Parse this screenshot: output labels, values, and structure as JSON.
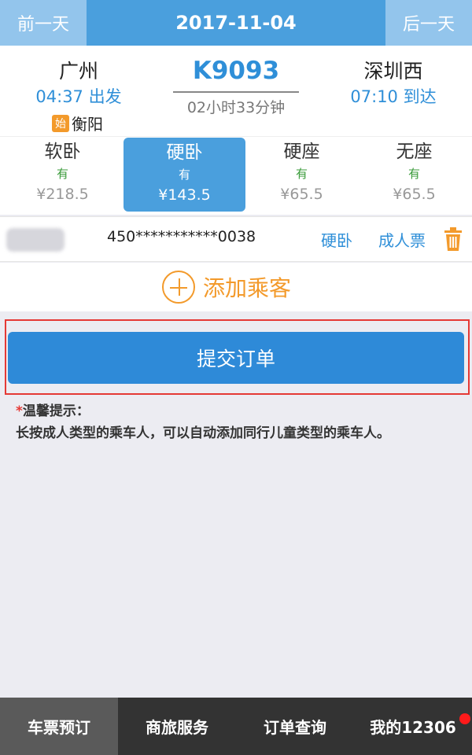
{
  "datebar": {
    "prev_label": "前一天",
    "date": "2017-11-04",
    "next_label": "后一天"
  },
  "train": {
    "from_station": "广州",
    "from_time": "04:37 出发",
    "origin_badge": "始",
    "origin_station": "衡阳",
    "number": "K9093",
    "duration": "02小时33分钟",
    "to_station": "深圳西",
    "to_time": "07:10 到达"
  },
  "seats": [
    {
      "name": "软卧",
      "availability": "有",
      "price": "¥218.5",
      "selected": false
    },
    {
      "name": "硬卧",
      "availability": "有",
      "price": "¥143.5",
      "selected": true
    },
    {
      "name": "硬座",
      "availability": "有",
      "price": "¥65.5",
      "selected": false
    },
    {
      "name": "无座",
      "availability": "有",
      "price": "¥65.5",
      "selected": false
    }
  ],
  "passenger": {
    "id_number": "450***********0038",
    "seat_type": "硬卧",
    "ticket_type": "成人票",
    "delete_icon": "trash-icon"
  },
  "add_passenger": {
    "label": "添加乘客",
    "icon": "plus-circle-icon"
  },
  "submit": {
    "label": "提交订单"
  },
  "tips": {
    "star": "*",
    "title": "温馨提示：",
    "body": "长按成人类型的乘车人，可以自动添加同行儿童类型的乘车人。"
  },
  "tabs": [
    {
      "label": "车票预订",
      "active": true
    },
    {
      "label": "商旅服务",
      "active": false
    },
    {
      "label": "订单查询",
      "active": false
    },
    {
      "label": "我的12306",
      "active": false,
      "badge_dot": true
    }
  ],
  "colors": {
    "primary": "#4a9fdd",
    "accent": "#f39a2b",
    "alert": "#e53935"
  }
}
